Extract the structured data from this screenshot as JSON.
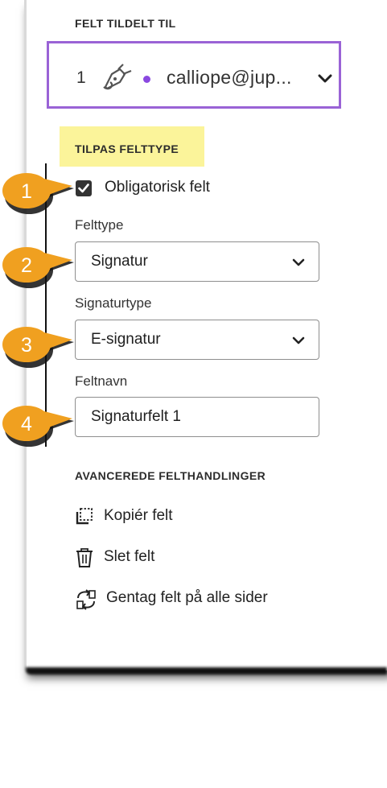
{
  "assigned_to": {
    "section_label": "FELT TILDELT TIL",
    "number": "1",
    "email": "calliope@jup...",
    "accent_color": "#9a63d6",
    "dot_color": "#8a48e0"
  },
  "customize": {
    "section_label": "TILPAS FELTTYPE",
    "highlight_color": "#fbf49a",
    "required_label": "Obligatorisk felt",
    "required_checked": true,
    "field_type_label": "Felttype",
    "field_type_value": "Signatur",
    "signature_type_label": "Signaturtype",
    "signature_type_value": "E-signatur",
    "field_name_label": "Feltnavn",
    "field_name_value": "Signaturfelt 1"
  },
  "callouts": [
    "1",
    "2",
    "3",
    "4"
  ],
  "callout_color": "#f0a020",
  "advanced": {
    "section_label": "AVANCEREDE FELTHANDLINGER",
    "actions": [
      {
        "label": "Kopiér felt",
        "icon": "copy-icon"
      },
      {
        "label": "Slet felt",
        "icon": "trash-icon"
      },
      {
        "label": "Gentag felt på alle sider",
        "icon": "repeat-icon"
      }
    ]
  }
}
